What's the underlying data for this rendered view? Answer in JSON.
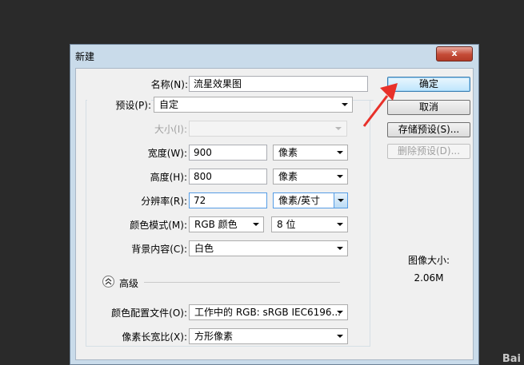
{
  "dialog": {
    "title": "新建",
    "close_label": "x"
  },
  "form": {
    "name": {
      "label": "名称(N):",
      "value": "流星效果图"
    },
    "preset": {
      "label": "预设(P):",
      "value": "自定"
    },
    "size": {
      "label": "大小(I):",
      "value": ""
    },
    "width": {
      "label": "宽度(W):",
      "value": "900",
      "unit": "像素"
    },
    "height": {
      "label": "高度(H):",
      "value": "800",
      "unit": "像素"
    },
    "resolution": {
      "label": "分辨率(R):",
      "value": "72",
      "unit": "像素/英寸"
    },
    "color_mode": {
      "label": "颜色模式(M):",
      "value": "RGB 颜色",
      "depth": "8 位"
    },
    "background": {
      "label": "背景内容(C):",
      "value": "白色"
    },
    "advanced": {
      "label": "高级"
    },
    "color_profile": {
      "label": "颜色配置文件(O):",
      "value": "工作中的 RGB: sRGB IEC6196..."
    },
    "pixel_aspect": {
      "label": "像素长宽比(X):",
      "value": "方形像素"
    }
  },
  "buttons": {
    "ok": "确定",
    "cancel": "取消",
    "save_preset": "存储预设(S)...",
    "delete_preset": "删除预设(D)..."
  },
  "image_size": {
    "label": "图像大小:",
    "value": "2.06M"
  },
  "annotation": {
    "arrow_color": "#e8312a"
  },
  "watermark": "Bai"
}
